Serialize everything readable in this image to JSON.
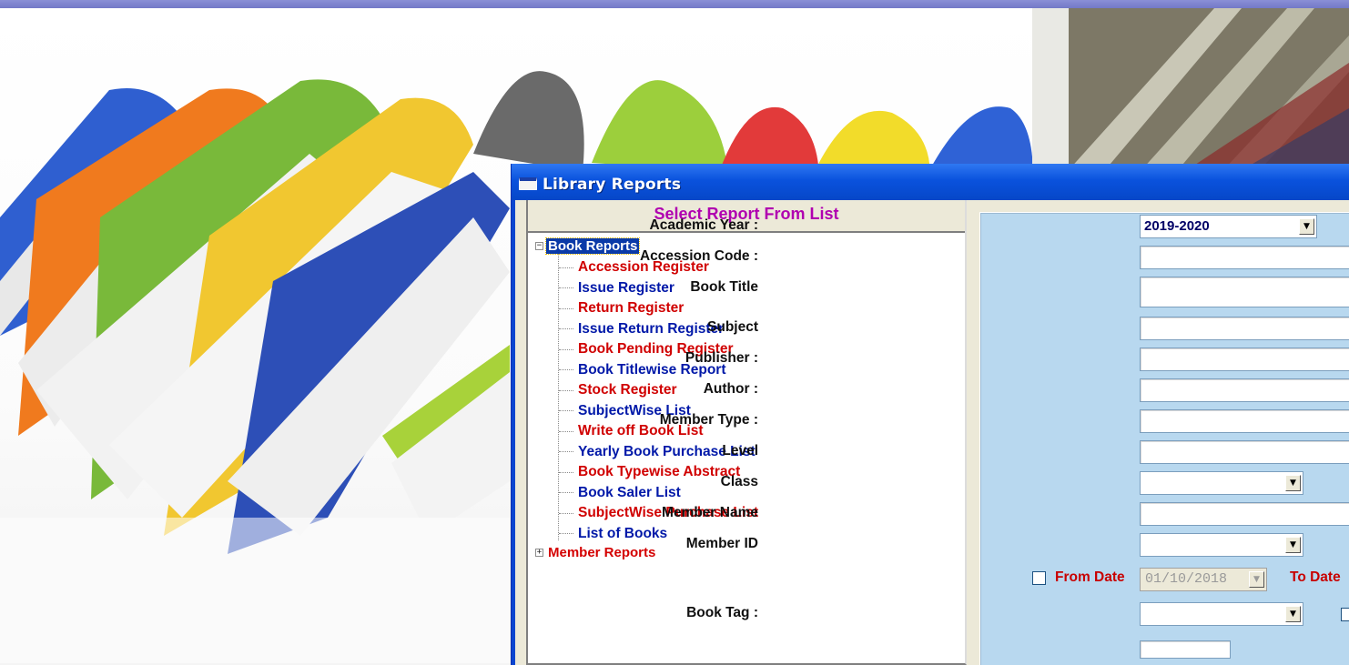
{
  "window": {
    "title": "Library Reports",
    "left_panel_header": "Select Report From List"
  },
  "tree": {
    "book_reports": {
      "label": "Book Reports",
      "expanded": true,
      "children": [
        {
          "label": "Accession Register",
          "color": "red"
        },
        {
          "label": "Issue Register",
          "color": "blue"
        },
        {
          "label": "Return Register",
          "color": "red"
        },
        {
          "label": "Issue Return Register",
          "color": "blue"
        },
        {
          "label": "Book Pending Register",
          "color": "red"
        },
        {
          "label": "Book Titlewise Report",
          "color": "blue"
        },
        {
          "label": "Stock Register",
          "color": "red"
        },
        {
          "label": "SubjectWise List",
          "color": "blue"
        },
        {
          "label": "Write off Book List",
          "color": "red"
        },
        {
          "label": "Yearly Book Purchase List",
          "color": "blue"
        },
        {
          "label": "Book Typewise Abstract",
          "color": "red"
        },
        {
          "label": "Book Saler List",
          "color": "blue"
        },
        {
          "label": "SubjectWise Purchase List",
          "color": "red"
        },
        {
          "label": "List of Books",
          "color": "blue"
        }
      ]
    },
    "member_reports": {
      "label": "Member Reports",
      "expanded": false
    }
  },
  "filters": {
    "academic_year": {
      "label": "Academic Year :",
      "value": "2019-2020"
    },
    "accession_code": {
      "label": "Accession Code :",
      "value": ""
    },
    "book_title": {
      "label": "Book Title",
      "value": ""
    },
    "subject": {
      "label": "Subject",
      "value": ""
    },
    "publisher": {
      "label": "Publisher :",
      "value": ""
    },
    "author": {
      "label": "Author :",
      "value": ""
    },
    "member_type": {
      "label": "Member Type :",
      "value": ""
    },
    "level": {
      "label": "Level",
      "value": ""
    },
    "class": {
      "label": "Class",
      "value": ""
    },
    "member_name": {
      "label": "Member Name",
      "value": ""
    },
    "member_id": {
      "label": "Member ID",
      "value": ""
    },
    "from_date": {
      "label": "From Date",
      "value": "01/10/2018",
      "checked": false
    },
    "to_date": {
      "label": "To Date"
    },
    "book_tag": {
      "label": "Book Tag :",
      "value": ""
    }
  },
  "colors": {
    "titlebar": "#0a52dd",
    "filter_panel": "#b8d8ef",
    "tree_red": "#d00000",
    "tree_blue": "#0018a8",
    "header_text": "#b000b0"
  },
  "icons": {
    "expand_collapsed": "plus-box",
    "expand_open": "minus-box",
    "dropdown": "triangle-down"
  }
}
